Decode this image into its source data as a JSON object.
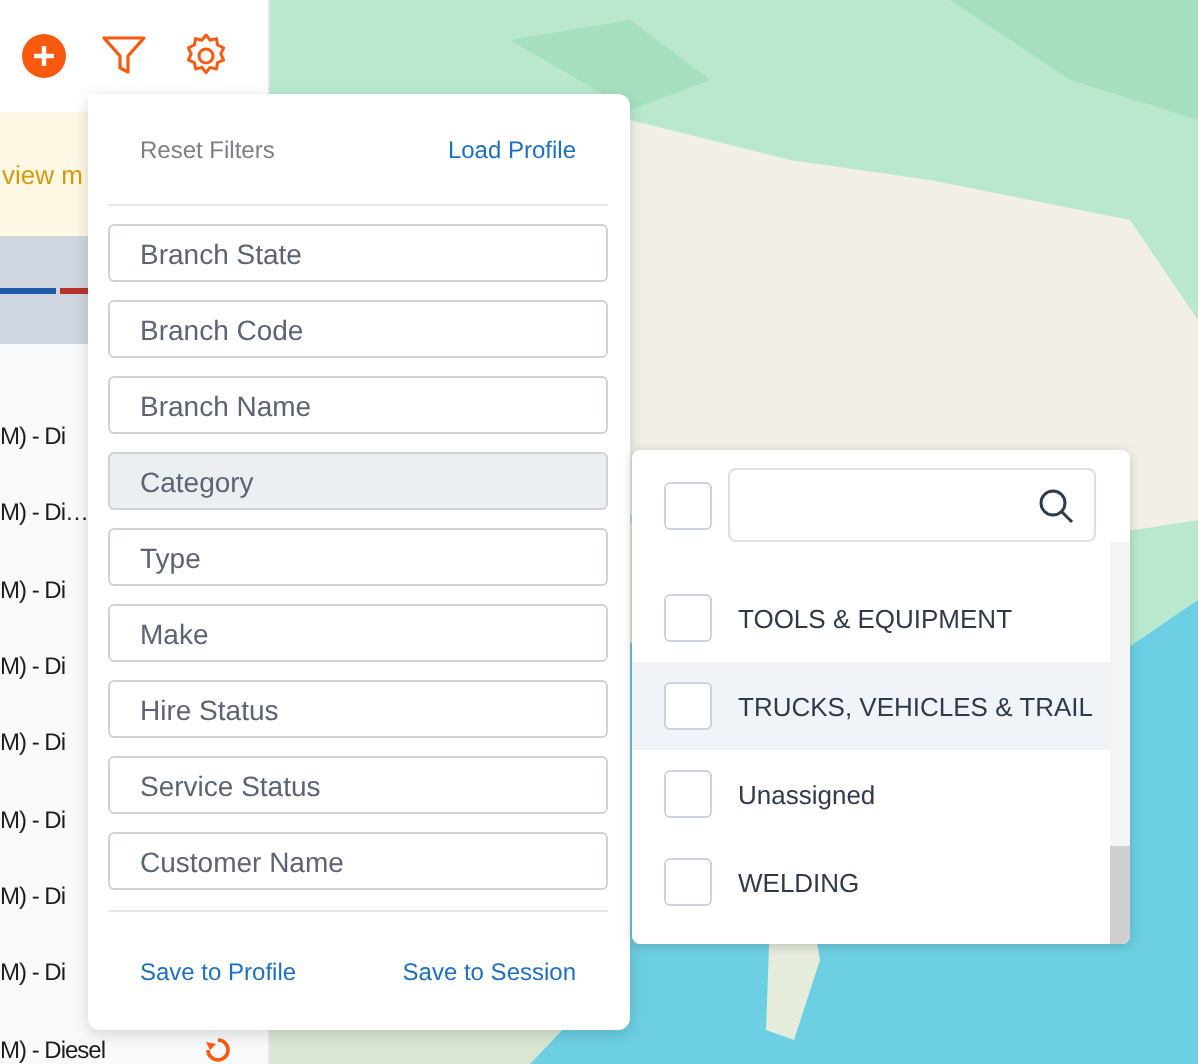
{
  "sidebar": {
    "notice": "view m",
    "rows": [
      {
        "text": "M) - Di"
      },
      {
        "text": "M) - Di…"
      },
      {
        "text": "M) - Di"
      },
      {
        "text": "M) - Di"
      },
      {
        "text": "M) - Di"
      },
      {
        "text": "M) - Di"
      },
      {
        "text": "M) - Di"
      },
      {
        "text": "M) - Di"
      },
      {
        "text": "M) - Diesel",
        "icon": true
      }
    ]
  },
  "filter_panel": {
    "reset": "Reset Filters",
    "load_profile": "Load Profile",
    "fields": [
      {
        "placeholder": "Branch State",
        "active": false
      },
      {
        "placeholder": "Branch Code",
        "active": false
      },
      {
        "placeholder": "Branch Name",
        "active": false
      },
      {
        "placeholder": "Category",
        "active": true
      },
      {
        "placeholder": "Type",
        "active": false
      },
      {
        "placeholder": "Make",
        "active": false
      },
      {
        "placeholder": "Hire Status",
        "active": false
      },
      {
        "placeholder": "Service Status",
        "active": false
      },
      {
        "placeholder": "Customer Name",
        "active": false
      }
    ],
    "save_profile": "Save to Profile",
    "save_session": "Save to Session"
  },
  "category_dropdown": {
    "select_all_checked": false,
    "options": [
      {
        "label": "TOOLS & EQUIPMENT",
        "checked": false,
        "highlighted": false
      },
      {
        "label": "TRUCKS, VEHICLES & TRAIL",
        "checked": false,
        "highlighted": true
      },
      {
        "label": "Unassigned",
        "checked": false,
        "highlighted": false
      },
      {
        "label": "WELDING",
        "checked": false,
        "highlighted": false
      }
    ]
  }
}
